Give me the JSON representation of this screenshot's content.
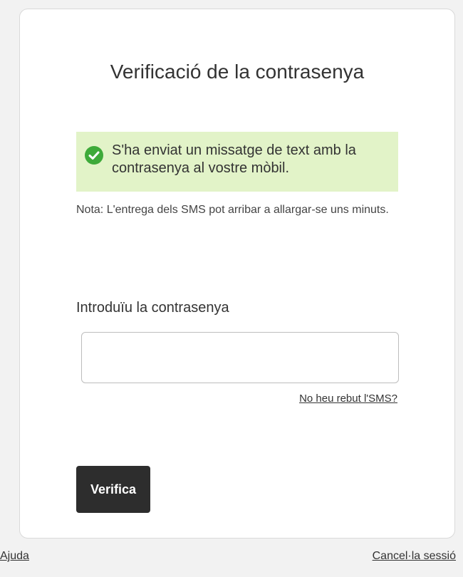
{
  "page": {
    "title": "Verificació de la contrasenya"
  },
  "alert": {
    "icon": "check-circle-icon",
    "color": "#e2f3c8",
    "icon_color": "#3eaa3a",
    "message": "S'ha enviat un missatge de text amb la contrasenya al vostre mòbil."
  },
  "note": "Nota: L'entrega dels SMS pot arribar a allargar-se uns minuts.",
  "form": {
    "password_label": "Introduïu la contrasenya",
    "password_value": "",
    "resend_link": "No heu rebut l'SMS?",
    "verify_label": "Verifica"
  },
  "footer": {
    "help_link": "Ajuda",
    "cancel_link": "Cancel·la sessió"
  }
}
